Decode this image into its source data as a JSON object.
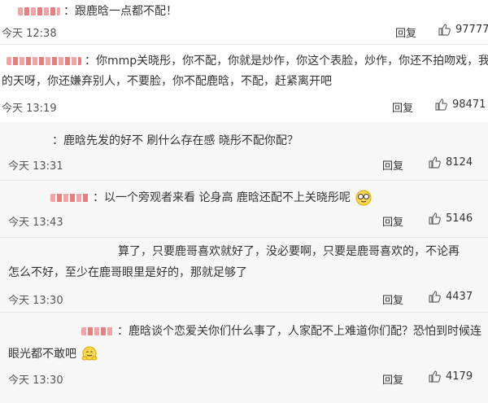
{
  "comments": [
    {
      "text": "：跟鹿晗一点都不配！",
      "time": "今天 12:38",
      "reply": "回复",
      "likes": "97777"
    },
    {
      "text1": "：你mmp关晓彤，你不配，你就是炒作，你这个表脸，炒作，你还不拍吻戏，我",
      "text2": "的天呀，你还嫌弃别人，不要脸，你不配鹿晗，不配，赶紧离开吧",
      "time": "今天 13:19",
      "reply": "回复",
      "likes": "98471"
    },
    {
      "text": "：鹿晗先发的好不 刷什么存在感 晓彤不配你配？",
      "time": "今天 13:31",
      "reply": "回复",
      "likes": "8124"
    },
    {
      "text": "：以一个旁观者来看 论身高 鹿晗还配不上关晓彤呢",
      "time": "今天 13:43",
      "reply": "回复",
      "likes": "5146",
      "emoji": "glasses-face-emoji"
    },
    {
      "text1": "算了，只要鹿哥喜欢就好了，没必要啊，只要是鹿哥喜欢的，不论再",
      "text2": "怎么不好，至少在鹿哥眼里是好的，那就足够了",
      "time": "今天 13:30",
      "reply": "回复",
      "likes": "4437"
    },
    {
      "text1": "：鹿晗谈个恋爱关你们什么事了，人家配不上难道你们配？恐怕到时候连",
      "text2": "眼光都不敢吧",
      "time": "今天 13:30",
      "reply": "回复",
      "likes": "4179",
      "emoji": "hugging-face-emoji"
    }
  ],
  "colors": {
    "accent_name": "#f2a3a3",
    "like_icon": "#666666"
  }
}
